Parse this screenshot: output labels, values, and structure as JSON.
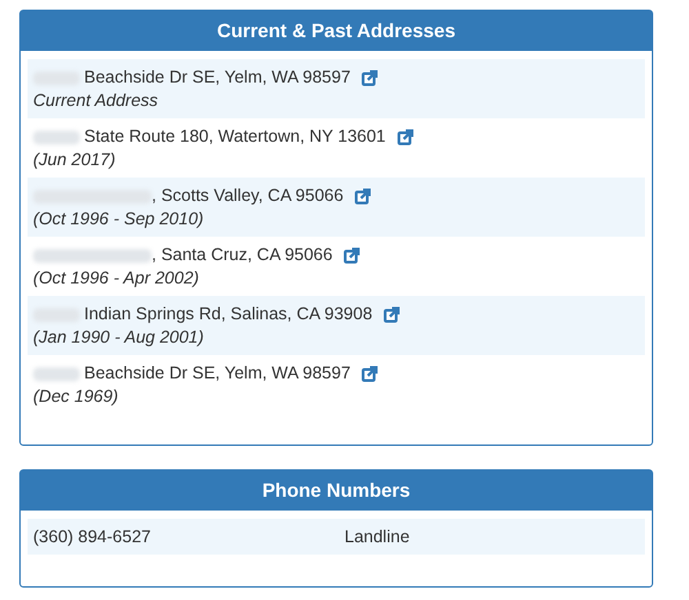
{
  "addresses_panel": {
    "title": "Current & Past Addresses",
    "addresses": [
      {
        "kind": "blurred_number",
        "street": "Beachside Dr SE, Yelm, WA 98597",
        "dates": "Current Address"
      },
      {
        "kind": "blurred_number",
        "street": "State Route 180, Watertown, NY 13601",
        "dates": "(Jun 2017)"
      },
      {
        "kind": "blurred_street",
        "street": ", Scotts Valley, CA 95066",
        "dates": "(Oct 1996 - Sep 2010)"
      },
      {
        "kind": "blurred_street",
        "street": ", Santa Cruz, CA 95066",
        "dates": "(Oct 1996 - Apr 2002)"
      },
      {
        "kind": "blurred_number",
        "street": "Indian Springs Rd, Salinas, CA 93908",
        "dates": "(Jan 1990 - Aug 2001)"
      },
      {
        "kind": "blurred_number",
        "street": "Beachside Dr SE, Yelm, WA 98597",
        "dates": "(Dec 1969)"
      }
    ]
  },
  "phones_panel": {
    "title": "Phone Numbers",
    "phones": [
      {
        "number": "(360) 894-6527",
        "type": "Landline"
      }
    ]
  }
}
